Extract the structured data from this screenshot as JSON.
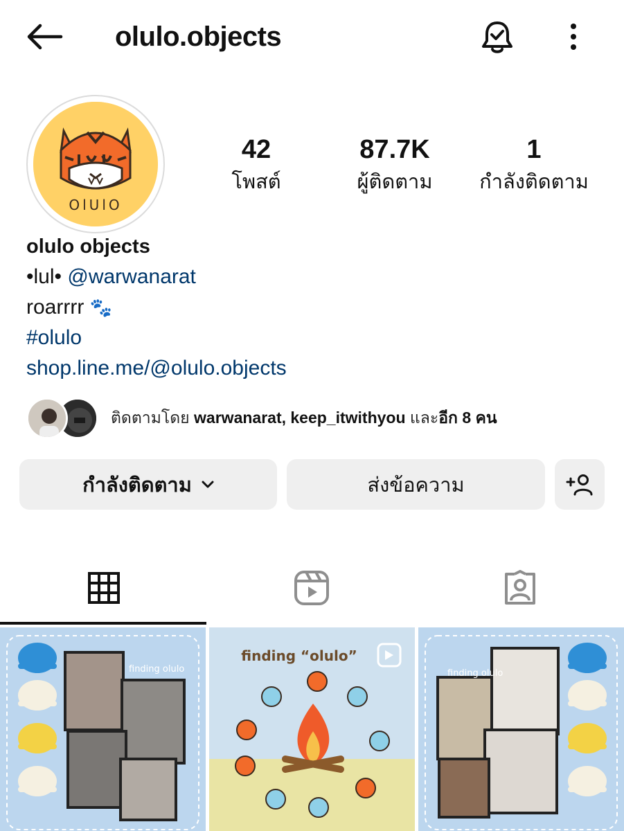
{
  "header": {
    "username": "olulo.objects",
    "icons": {
      "back": "back-arrow-icon",
      "bell": "notification-bell-icon",
      "more": "more-vertical-icon"
    }
  },
  "stats": {
    "posts": {
      "value": "42",
      "label": "โพสต์"
    },
    "followers": {
      "value": "87.7K",
      "label": "ผู้ติดตาม"
    },
    "following": {
      "value": "1",
      "label": "กำลังติดตาม"
    }
  },
  "avatar": {
    "logo_text": "OlUlO"
  },
  "bio": {
    "name": "olulo objects",
    "line2_prefix": "•lul• ",
    "line2_mention": "@warwanarat",
    "line3": "roarrrr",
    "line3_emoji": "🐾",
    "hashtag": "#olulo",
    "link": "shop.line.me/@olulo.objects"
  },
  "followed_by": {
    "prefix": "ติดตามโดย ",
    "names": "warwanarat, keep_itwithyou",
    "suffix_plain": " และ",
    "suffix_bold": "อีก 8 คน"
  },
  "buttons": {
    "following": "กำลังติดตาม",
    "message": "ส่งข้อความ",
    "add_user_icon": "add-user-icon"
  },
  "tabs": [
    {
      "name": "posts-grid",
      "icon": "grid-icon",
      "active": true
    },
    {
      "name": "reels",
      "icon": "reels-icon",
      "active": false
    },
    {
      "name": "tagged",
      "icon": "tagged-person-icon",
      "active": false
    }
  ],
  "grid": {
    "post2_title": "finding “olulo”",
    "post1_caption": "finding olulo",
    "post3_caption": "finding olulo"
  },
  "colors": {
    "link": "#00376b",
    "button_bg": "#efefef",
    "avatar_bg": "#ffd166"
  }
}
